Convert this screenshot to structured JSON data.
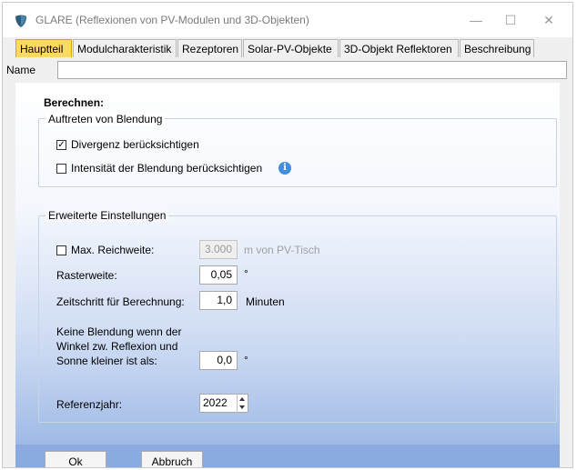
{
  "window": {
    "title": "GLARE (Reflexionen von PV-Modulen und 3D-Objekten)",
    "minimize": "—",
    "maximize": "☐",
    "close": "✕"
  },
  "tabs": [
    {
      "label": "Hauptteil",
      "active": true
    },
    {
      "label": "Modulcharakteristik"
    },
    {
      "label": "Rezeptoren"
    },
    {
      "label": "Solar-PV-Objekte"
    },
    {
      "label": "3D-Objekt Reflektoren"
    },
    {
      "label": "Beschreibung"
    }
  ],
  "name": {
    "label": "Name",
    "value": ""
  },
  "berechnen": {
    "heading": "Berechnen:"
  },
  "group_blendung": {
    "title": "Auftreten von Blendung",
    "divergenz": {
      "label": "Divergenz berücksichtigen",
      "checked": true,
      "mark": "✓"
    },
    "intensitaet": {
      "label": "Intensität der Blendung berücksichtigen",
      "checked": false,
      "info": "i"
    }
  },
  "group_erweitert": {
    "title": "Erweiterte Einstellungen",
    "max_reichweite": {
      "label": "Max. Reichweite:",
      "checked": false,
      "value": "3.000",
      "unit": "m von PV-Tisch"
    },
    "rasterweite": {
      "label": "Rasterweite:",
      "value": "0,05",
      "unit": "°"
    },
    "zeitschritt": {
      "label": "Zeitschritt für Berechnung:",
      "value": "1,0",
      "unit": "Minuten"
    },
    "keine_blendung": {
      "line1": "Keine Blendung wenn der",
      "line2": "Winkel zw. Reflexion und",
      "line3": "Sonne kleiner ist als:",
      "value": "0,0",
      "unit": "°"
    },
    "referenzjahr": {
      "label": "Referenzjahr:",
      "value": "2022"
    }
  },
  "footer": {
    "ok": "Ok",
    "cancel": "Abbruch"
  },
  "colors": {
    "tab_active": "#ffd866",
    "info": "#3f8ee0",
    "footer": "#8aaae0"
  }
}
